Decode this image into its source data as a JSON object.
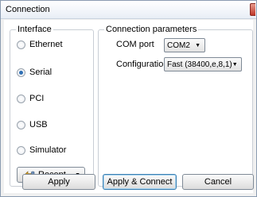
{
  "window": {
    "title": "Connection"
  },
  "interface": {
    "legend": "Interface",
    "options": [
      {
        "label": "Ethernet",
        "checked": false
      },
      {
        "label": "Serial",
        "checked": true
      },
      {
        "label": "PCI",
        "checked": false
      },
      {
        "label": "USB",
        "checked": false
      },
      {
        "label": "Simulator",
        "checked": false
      }
    ],
    "recent_label": "Recent..."
  },
  "params": {
    "legend": "Connection parameters",
    "com_port_label": "COM port",
    "com_port_value": "COM2",
    "config_label": "Configuration",
    "config_value": "Fast (38400,e,8,1)"
  },
  "buttons": {
    "apply": "Apply",
    "apply_connect": "Apply & Connect",
    "cancel": "Cancel"
  },
  "icons": {
    "close": "close-icon",
    "recent": "recent-icon",
    "dropdown": "chevron-down-icon"
  }
}
